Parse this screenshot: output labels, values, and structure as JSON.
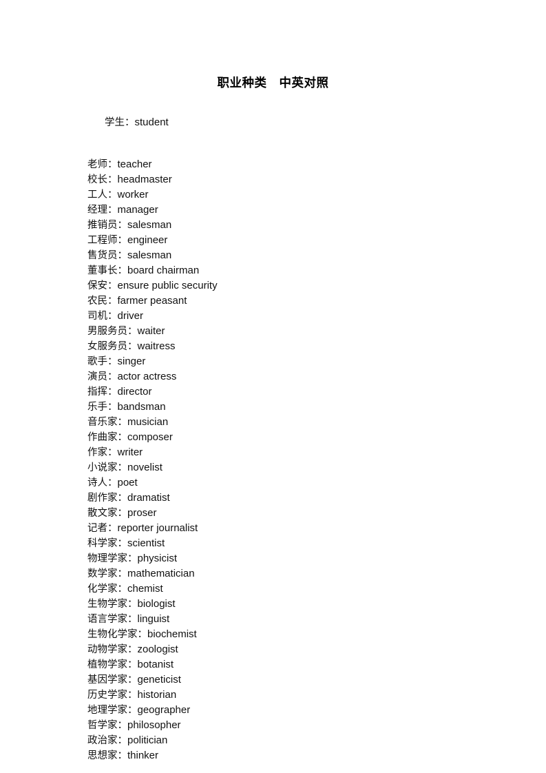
{
  "document": {
    "title": "职业种类　中英对照",
    "separator": "：",
    "first_entry": {
      "term": "学生",
      "gloss": "student"
    },
    "entries": [
      {
        "term": "老师",
        "gloss": "teacher"
      },
      {
        "term": "校长",
        "gloss": "headmaster"
      },
      {
        "term": "工人",
        "gloss": "worker"
      },
      {
        "term": "经理",
        "gloss": "manager"
      },
      {
        "term": "推销员",
        "gloss": "salesman"
      },
      {
        "term": "工程师",
        "gloss": "engineer"
      },
      {
        "term": "售货员",
        "gloss": "salesman"
      },
      {
        "term": "董事长",
        "gloss": "board chairman"
      },
      {
        "term": "保安",
        "gloss": "ensure public security"
      },
      {
        "term": "农民",
        "gloss": "farmer peasant"
      },
      {
        "term": "司机",
        "gloss": "driver"
      },
      {
        "term": "男服务员",
        "gloss": "waiter"
      },
      {
        "term": "女服务员",
        "gloss": "waitress"
      },
      {
        "term": "歌手",
        "gloss": "singer"
      },
      {
        "term": "演员",
        "gloss": "actor actress"
      },
      {
        "term": "指挥",
        "gloss": "director"
      },
      {
        "term": "乐手",
        "gloss": "bandsman"
      },
      {
        "term": "音乐家",
        "gloss": "musician"
      },
      {
        "term": "作曲家",
        "gloss": "composer"
      },
      {
        "term": "作家",
        "gloss": "writer"
      },
      {
        "term": "小说家",
        "gloss": "novelist"
      },
      {
        "term": "诗人",
        "gloss": "poet"
      },
      {
        "term": "剧作家",
        "gloss": "dramatist"
      },
      {
        "term": "散文家",
        "gloss": "proser"
      },
      {
        "term": "记者",
        "gloss": "reporter journalist"
      },
      {
        "term": "科学家",
        "gloss": "scientist"
      },
      {
        "term": "物理学家",
        "gloss": "physicist"
      },
      {
        "term": "数学家",
        "gloss": "mathematician"
      },
      {
        "term": "化学家",
        "gloss": "chemist"
      },
      {
        "term": "生物学家",
        "gloss": "biologist"
      },
      {
        "term": "语言学家",
        "gloss": "linguist"
      },
      {
        "term": "生物化学家",
        "gloss": "biochemist"
      },
      {
        "term": "动物学家",
        "gloss": "zoologist"
      },
      {
        "term": "植物学家",
        "gloss": "botanist"
      },
      {
        "term": "基因学家",
        "gloss": "geneticist"
      },
      {
        "term": "历史学家",
        "gloss": "historian"
      },
      {
        "term": "地理学家",
        "gloss": "geographer"
      },
      {
        "term": "哲学家",
        "gloss": "philosopher"
      },
      {
        "term": "政治家",
        "gloss": "politician"
      },
      {
        "term": "思想家",
        "gloss": "thinker"
      }
    ]
  }
}
